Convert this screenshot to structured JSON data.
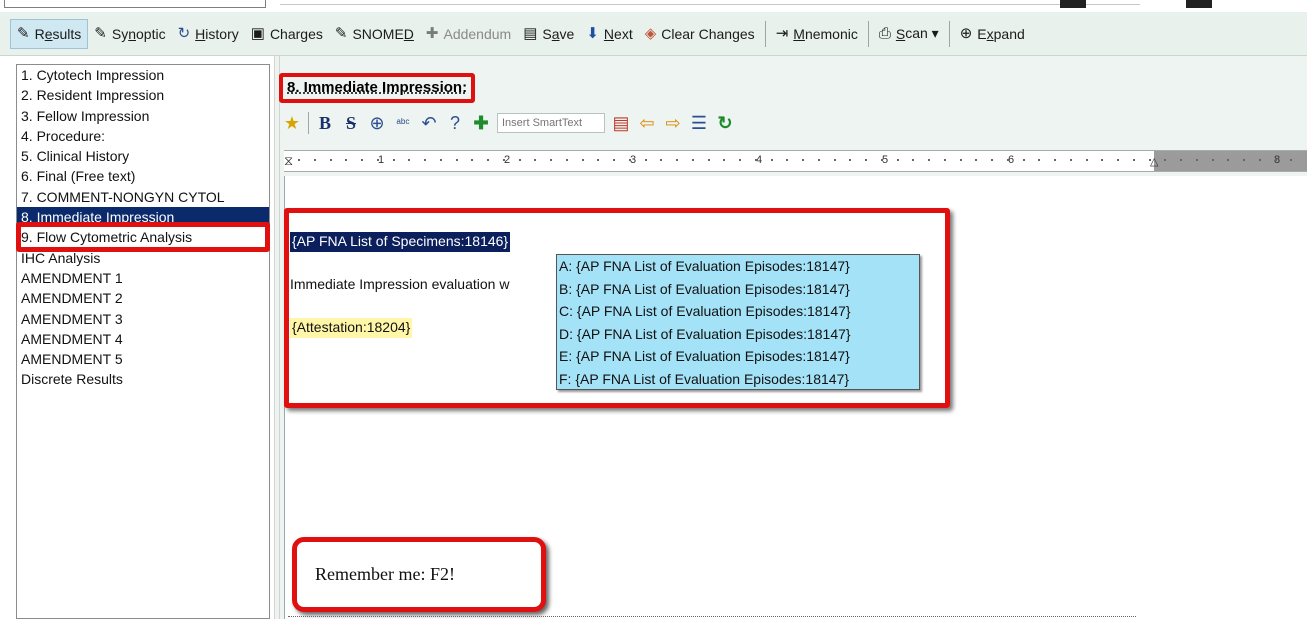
{
  "toolbar": {
    "items": [
      {
        "id": "results",
        "pre": "R",
        "ul": "e",
        "post": "sults",
        "icon": "pencil-icon",
        "glyph": "✎"
      },
      {
        "id": "synoptic",
        "pre": "Sy",
        "ul": "n",
        "post": "optic",
        "icon": "pencil-icon",
        "glyph": "✎"
      },
      {
        "id": "history",
        "pre": "",
        "ul": "H",
        "post": "istory",
        "icon": "history-icon",
        "glyph": "↻"
      },
      {
        "id": "charges",
        "pre": "Charges",
        "ul": "",
        "post": "",
        "icon": "charges-icon",
        "glyph": "▣"
      },
      {
        "id": "snomed",
        "pre": "SNOME",
        "ul": "D",
        "post": "",
        "icon": "pencil-icon",
        "glyph": "✎"
      },
      {
        "id": "addendum",
        "pre": "Addendum",
        "ul": "",
        "post": "",
        "icon": "plus-icon",
        "glyph": "✚"
      },
      {
        "id": "save",
        "pre": "S",
        "ul": "a",
        "post": "ve",
        "icon": "save-icon",
        "glyph": "▤"
      },
      {
        "id": "next",
        "pre": "",
        "ul": "N",
        "post": "ext",
        "icon": "down-arrow-icon",
        "glyph": "⬇"
      },
      {
        "id": "clear",
        "pre": "Clear Chan",
        "ul": "g",
        "post": "es",
        "icon": "eraser-icon",
        "glyph": "◈"
      },
      {
        "id": "mnemonic",
        "pre": "",
        "ul": "M",
        "post": "nemonic",
        "icon": "mnemonic-icon",
        "glyph": "⇥"
      },
      {
        "id": "scan",
        "pre": "",
        "ul": "S",
        "post": "can ▾",
        "icon": "scan-icon",
        "glyph": "⎙"
      },
      {
        "id": "expand",
        "pre": "E",
        "ul": "x",
        "post": "pand",
        "icon": "zoom-in-icon",
        "glyph": "⊕"
      }
    ]
  },
  "leftnav": {
    "items": [
      "1. Cytotech Impression",
      "2. Resident Impression",
      "3. Fellow Impression",
      "4. Procedure:",
      "5. Clinical History",
      "6. Final (Free text)",
      "7. COMMENT-NONGYN CYTOL",
      "8. Immediate Impression",
      "9. Flow Cytometric Analysis",
      "IHC Analysis",
      "AMENDMENT 1",
      "AMENDMENT 2",
      "AMENDMENT 3",
      "AMENDMENT 4",
      "AMENDMENT 5",
      "Discrete Results"
    ],
    "selected_index": 7
  },
  "section": {
    "title": "8. Immediate Impression:"
  },
  "format_bar": {
    "smarttext_placeholder": "Insert SmartText"
  },
  "ruler": {
    "numbers": [
      "1",
      "2",
      "3",
      "4",
      "5",
      "6",
      "8"
    ]
  },
  "editor": {
    "line1": "{AP FNA List of Specimens:18146}",
    "line2": "Immediate Impression evaluation w",
    "line3": "{Attestation:18204}",
    "dropdown": [
      "A:  {AP FNA List of Evaluation Episodes:18147}",
      "B:  {AP FNA List of Evaluation Episodes:18147}",
      "C:  {AP FNA List of Evaluation Episodes:18147}",
      "D:  {AP FNA List of Evaluation Episodes:18147}",
      "E:  {AP FNA List of Evaluation Episodes:18147}",
      "F:  {AP FNA List of Evaluation Episodes:18147}"
    ]
  },
  "callout": {
    "text": "Remember me: F2!"
  },
  "colors": {
    "highlight_red": "#e01010",
    "selection_navy": "#0a1f5c",
    "smartlist_blue": "#a4e3f7",
    "attestation_yellow": "#fff6a8",
    "toolbar_bg": "#e8f1ec"
  }
}
